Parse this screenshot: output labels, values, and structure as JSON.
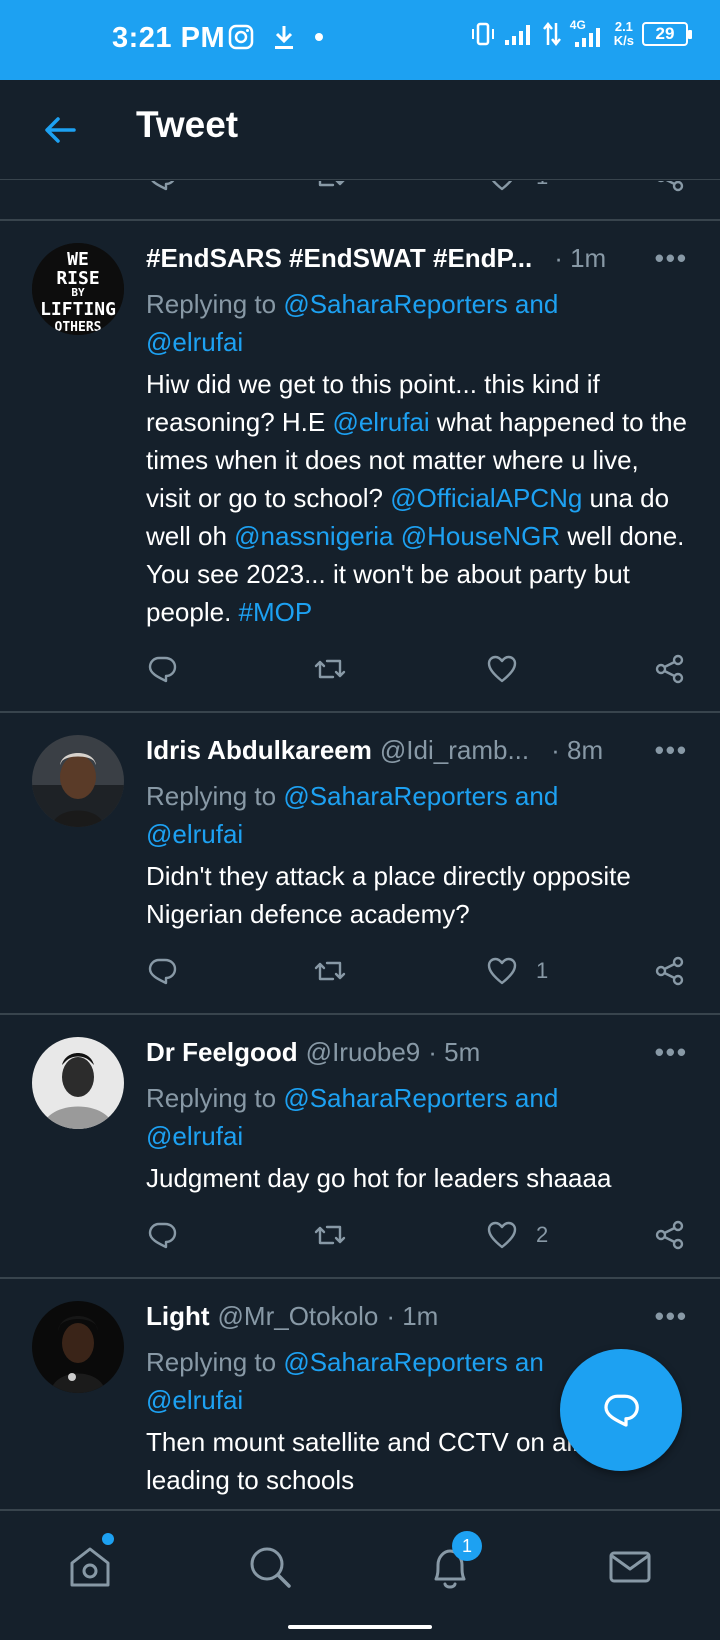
{
  "status_bar": {
    "time": "3:21 PM",
    "network_type": "4G",
    "speed_value": "2.1",
    "speed_unit": "K/s",
    "battery": "29"
  },
  "header": {
    "title": "Tweet"
  },
  "top_partial": {
    "like_count": "1"
  },
  "tweets": [
    {
      "name": "#EndSARS #EndSWAT #EndP...",
      "handle": "",
      "time": "· 1m",
      "reply_prefix": "Replying to ",
      "reply_to_1": "@SaharaReporters and",
      "reply_to_2": "@elrufai",
      "text_parts": [
        "Hiw did we get to this point... this kind if reasoning? H.E ",
        "@elrufai",
        " what happened to the times when it does not matter where u live, visit or go to school? ",
        "@OfficialAPCNg",
        " una do well oh ",
        "@nassnigeria",
        " ",
        "@HouseNGR",
        " well done. You see 2023... it won't be about party but people. ",
        "#MOP"
      ],
      "like_count": "",
      "avatar_text": [
        "WE",
        "RISE",
        "BY",
        "LIFTING",
        "OTHERS"
      ]
    },
    {
      "name": "Idris Abdulkareem",
      "handle": "@Idi_ramb...",
      "time": "· 8m",
      "reply_prefix": "Replying to ",
      "reply_to_1": "@SaharaReporters and",
      "reply_to_2": "@elrufai",
      "text": "Didn't they attack a place directly opposite Nigerian defence academy?",
      "like_count": "1"
    },
    {
      "name": "Dr Feelgood",
      "handle": "@Iruobe9",
      "time": "· 5m",
      "reply_prefix": "Replying to ",
      "reply_to_1": "@SaharaReporters and",
      "reply_to_2": "@elrufai",
      "text": "Judgment day go hot for leaders shaaaa",
      "like_count": "2"
    },
    {
      "name": "Light",
      "handle": "@Mr_Otokolo",
      "time": "· 1m",
      "reply_prefix": "Replying to ",
      "reply_to_1": "@SaharaReporters an",
      "reply_to_2": "@elrufai",
      "text": "Then mount satellite and CCTV on all streets leading to schools",
      "like_count": ""
    }
  ],
  "more_label": "•••",
  "bottom_nav": {
    "notifications_badge": "1"
  },
  "colors": {
    "background": "#15202b",
    "accent": "#1da1f2",
    "divider": "#38444d",
    "muted": "#8899a6"
  }
}
